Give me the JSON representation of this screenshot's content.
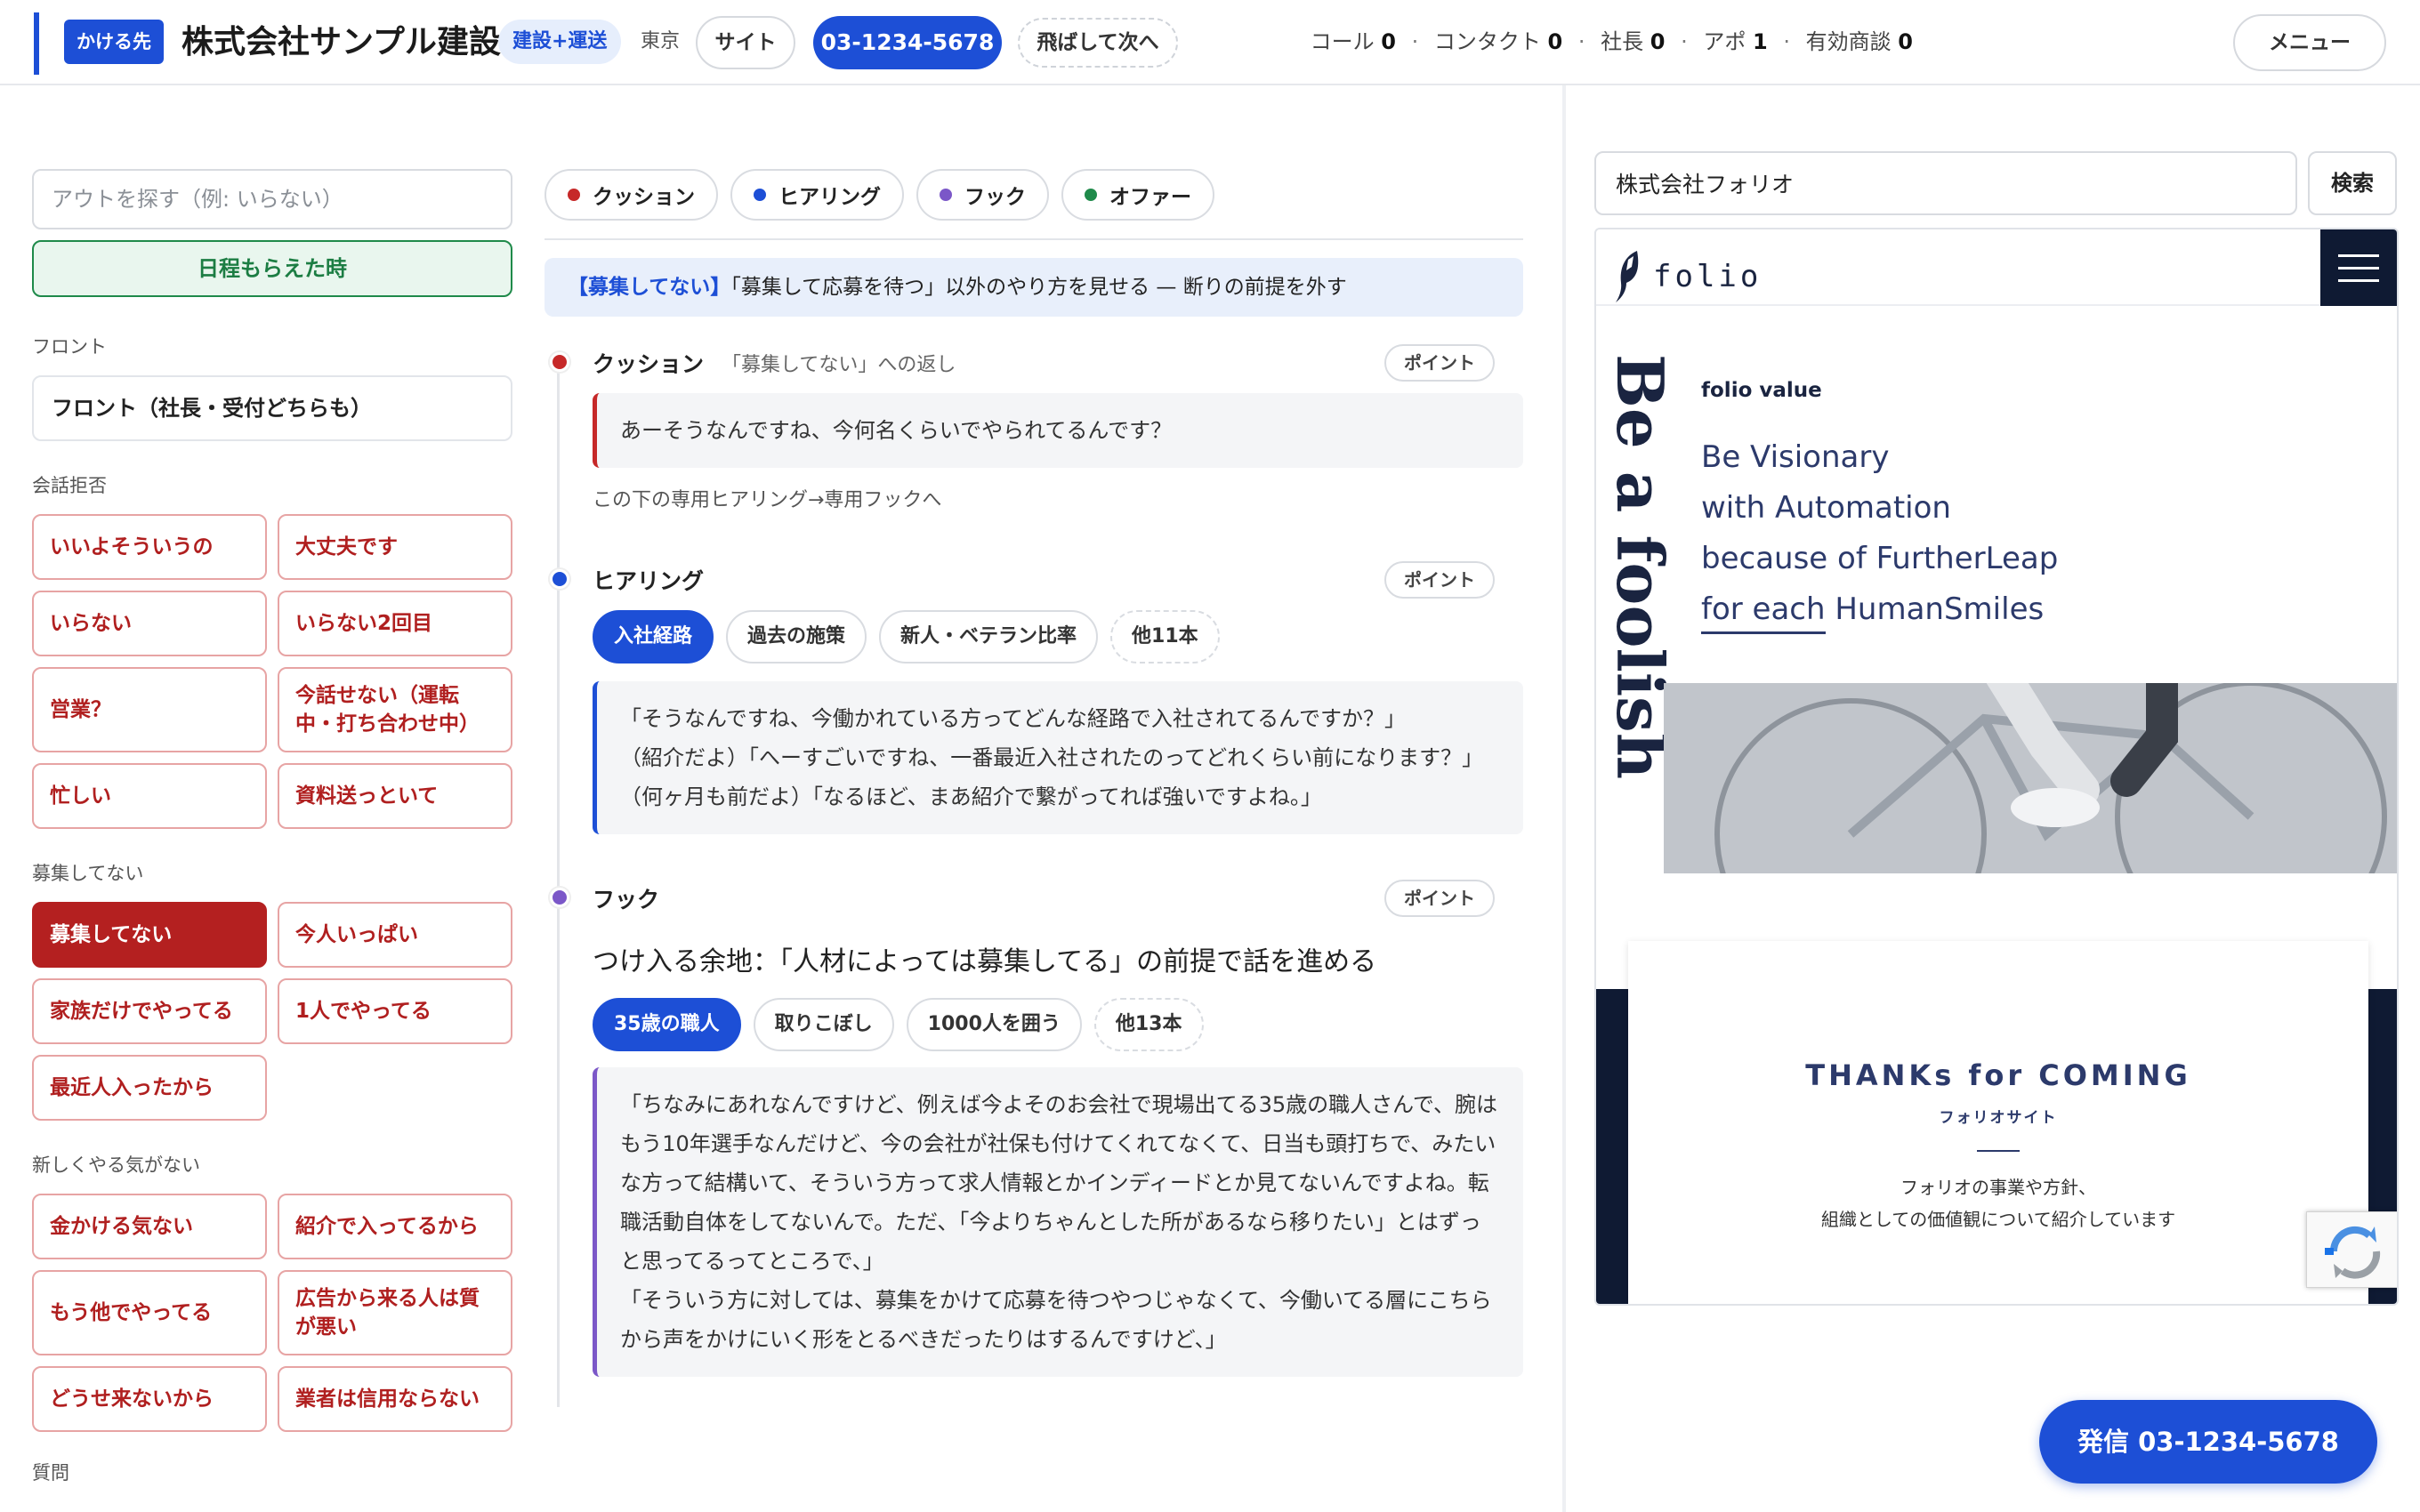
{
  "header": {
    "caller_label": "かける先",
    "company": "株式会社サンプル建設",
    "tag": "建設+運送",
    "city": "東京",
    "site_button": "サイト",
    "phone": "03-1234-5678",
    "skip_button": "飛ばして次へ",
    "stats": {
      "call_label": "コール",
      "call_value": "0",
      "contact_label": "コンタクト",
      "contact_value": "0",
      "president_label": "社長",
      "president_value": "0",
      "appo_label": "アポ",
      "appo_value": "1",
      "deal_label": "有効商談",
      "deal_value": "0"
    },
    "menu_button": "メニュー"
  },
  "left": {
    "search_placeholder": "アウトを探す（例: いらない）",
    "schedule_button": "日程もらえた時",
    "front_label": "フロント",
    "front_card": "フロント（社長・受付どちらも）",
    "sections": [
      {
        "label": "会話拒否",
        "items": [
          "いいよそういうの",
          "大丈夫です",
          "いらない",
          "いらない2回目",
          "営業？",
          "今話せない（運転中・打ち合わせ中）",
          "忙しい",
          "資料送っといて"
        ]
      },
      {
        "label": "募集してない",
        "items": [
          "募集してない",
          "今人いっぱい",
          "家族だけでやってる",
          "1人でやってる",
          "最近人入ったから"
        ]
      },
      {
        "label": "新しくやる気がない",
        "items": [
          "金かける気ない",
          "紹介で入ってるから",
          "もう他でやってる",
          "広告から来る人は質が悪い",
          "どうせ来ないから",
          "業者は信用ならない"
        ]
      }
    ],
    "last_label": "質問"
  },
  "middle": {
    "tabs": [
      {
        "label": "クッション",
        "color": "#c62828"
      },
      {
        "label": "ヒアリング",
        "color": "#1d4fd6"
      },
      {
        "label": "フック",
        "color": "#7b57c8"
      },
      {
        "label": "オファー",
        "color": "#1f8a4a"
      }
    ],
    "banner_em": "【募集してない】",
    "banner_text": "「募集して応募を待つ」以外のやり方を見せる — 断りの前提を外す",
    "point_label": "ポイント",
    "cushion": {
      "title": "クッション",
      "sub": "「募集してない」への返し",
      "quote": "あーそうなんですね、今何名くらいでやられてるんです？",
      "note": "この下の専用ヒアリング→専用フックへ"
    },
    "hearing": {
      "title": "ヒアリング",
      "chips": [
        "入社経路",
        "過去の施策",
        "新人・ベテラン比率",
        "他11本"
      ],
      "lines": [
        "「そうなんですね、今働かれている方ってどんな経路で入社されてるんですか？」",
        "（紹介だよ）「へーすごいですね、一番最近入社されたのってどれくらい前になります？」",
        "（何ヶ月も前だよ）「なるほど、まあ紹介で繋がってれば強いですよね。」"
      ]
    },
    "hook": {
      "title": "フック",
      "headline": "つけ入る余地：「人材によっては募集してる」の前提で話を進める",
      "chips": [
        "35歳の職人",
        "取りこぼし",
        "1000人を囲う",
        "他13本"
      ],
      "lines": [
        "「ちなみにあれなんですけど、例えば今よそのお会社で現場出てる35歳の職人さんで、腕はもう10年選手なんだけど、今の会社が社保も付けてくれてなくて、日当も頭打ちで、みたいな方って結構いて、そういう方って求人情報とかインディードとか見てないんですよね。転職活動自体をしてないんで。ただ、「今よりちゃんとした所があるなら移りたい」とはずっと思ってるってところで、」",
        "「そういう方に対しては、募集をかけて応募を待つやつじゃなくて、今働いてる層にこちらから声をかけにいく形をとるべきだったりはするんですけど、」"
      ]
    }
  },
  "right": {
    "search_value": "株式会社フォリオ",
    "search_button": "検索",
    "site": {
      "logo_text": "folio",
      "vertical_text": "Be a foolish",
      "value_label": "folio value",
      "value_lines": [
        "Be Visionary",
        "with Automation",
        "because of FurtherLeap",
        "for each HumanSmiles"
      ],
      "thanks_title": "THANKs for COMING",
      "thanks_sub": "フォリオサイト",
      "thanks_desc_1": "フォリオの事業や方針、",
      "thanks_desc_2": "組織としての価値観について紹介しています"
    }
  },
  "call_button": "発信 03-1234-5678"
}
